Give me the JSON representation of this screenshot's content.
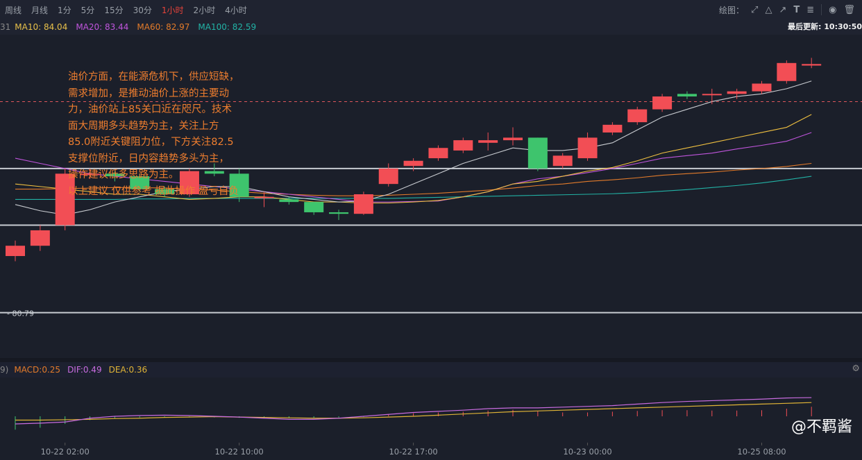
{
  "timeframes": [
    {
      "label": "周线",
      "active": false
    },
    {
      "label": "月线",
      "active": false
    },
    {
      "label": "1分",
      "active": false
    },
    {
      "label": "5分",
      "active": false
    },
    {
      "label": "15分",
      "active": false
    },
    {
      "label": "30分",
      "active": false
    },
    {
      "label": "1小时",
      "active": true
    },
    {
      "label": "2小时",
      "active": false
    },
    {
      "label": "4小时",
      "active": false
    }
  ],
  "drawing": {
    "label": "绘图："
  },
  "ma_bar": {
    "prefix": "31",
    "ma10": "MA10: 84.04",
    "ma20": "MA20: 83.44",
    "ma60": "MA60: 82.97",
    "ma100": "MA100: 82.59",
    "last_update": "最后更新: 10:30:50"
  },
  "macd_bar": {
    "prefix": "9)",
    "macd": "MACD:0.25",
    "dif": "DIF:0.49",
    "dea": "DEA:0.36"
  },
  "annotation": {
    "lines": [
      "油价方面，在能源危机下，供应短缺，",
      "需求增加，是推动油价上涨的主要动",
      "力，油价站上85关口近在咫尺。技术",
      "面大周期多头趋势为主，关注上方",
      "85.0附近关键阻力位，下方关注82.5",
      "支撑位附近，日内容趋势多头为主，",
      "操作建议低多思路为主。",
      "以上建议 仅供参考 据此操作 盈亏自负"
    ]
  },
  "watermark": {
    "text": "@不羁酱"
  },
  "colors": {
    "up": "#f24e55",
    "down": "#3ec46d",
    "ma10": "#c9ccd1",
    "ma20": "#f0c040",
    "ma60": "#c055dd",
    "ma100": "#e37b2a",
    "ma_extra": "#22b3a6",
    "dif": "#c96ce0",
    "dea": "#e0b436",
    "background": "#1b1f2a"
  },
  "chart_data": {
    "type": "candlestick",
    "price_label": "80.79",
    "current_price": 84.9,
    "x_tick_labels": [
      "10-22 02:00",
      "10-22 10:00",
      "10-22 17:00",
      "10-23 00:00",
      "10-25 08:00"
    ],
    "horizontal_levels": [
      83.6,
      82.5,
      80.8
    ],
    "candles": [
      {
        "o": 81.9,
        "c": 82.1,
        "h": 82.2,
        "l": 81.8
      },
      {
        "o": 82.1,
        "c": 82.4,
        "h": 82.5,
        "l": 82.0
      },
      {
        "o": 82.5,
        "c": 83.5,
        "h": 83.6,
        "l": 82.4
      },
      {
        "o": 83.5,
        "c": 83.5,
        "h": 83.6,
        "l": 83.4
      },
      {
        "o": 83.5,
        "c": 83.45,
        "h": 83.55,
        "l": 83.35
      },
      {
        "o": 83.45,
        "c": 83.2,
        "h": 83.5,
        "l": 83.15
      },
      {
        "o": 83.2,
        "c": 83.1,
        "h": 83.25,
        "l": 83.05
      },
      {
        "o": 83.1,
        "c": 83.55,
        "h": 83.6,
        "l": 83.05
      },
      {
        "o": 83.55,
        "c": 83.5,
        "h": 83.7,
        "l": 83.45
      },
      {
        "o": 83.5,
        "c": 83.05,
        "h": 83.6,
        "l": 82.95
      },
      {
        "o": 83.05,
        "c": 83.05,
        "h": 83.15,
        "l": 82.85
      },
      {
        "o": 83.0,
        "c": 82.95,
        "h": 83.05,
        "l": 82.9
      },
      {
        "o": 82.95,
        "c": 82.75,
        "h": 82.95,
        "l": 82.7
      },
      {
        "o": 82.75,
        "c": 82.72,
        "h": 82.8,
        "l": 82.6
      },
      {
        "o": 82.72,
        "c": 83.1,
        "h": 83.15,
        "l": 82.7
      },
      {
        "o": 83.3,
        "c": 83.6,
        "h": 83.7,
        "l": 83.25
      },
      {
        "o": 83.65,
        "c": 83.75,
        "h": 83.8,
        "l": 83.55
      },
      {
        "o": 83.8,
        "c": 84.0,
        "h": 84.05,
        "l": 83.75
      },
      {
        "o": 83.95,
        "c": 84.15,
        "h": 84.2,
        "l": 83.9
      },
      {
        "o": 84.1,
        "c": 84.15,
        "h": 84.3,
        "l": 83.95
      },
      {
        "o": 84.15,
        "c": 84.2,
        "h": 84.4,
        "l": 84.05
      },
      {
        "o": 84.2,
        "c": 83.6,
        "h": 84.2,
        "l": 83.55
      },
      {
        "o": 83.65,
        "c": 83.85,
        "h": 83.9,
        "l": 83.6
      },
      {
        "o": 83.8,
        "c": 84.2,
        "h": 84.3,
        "l": 83.75
      },
      {
        "o": 84.3,
        "c": 84.45,
        "h": 84.5,
        "l": 84.25
      },
      {
        "o": 84.5,
        "c": 84.75,
        "h": 84.8,
        "l": 84.45
      },
      {
        "o": 84.75,
        "c": 85.0,
        "h": 85.05,
        "l": 84.7
      },
      {
        "o": 85.05,
        "c": 85.0,
        "h": 85.1,
        "l": 84.95
      },
      {
        "o": 85.05,
        "c": 85.05,
        "h": 85.15,
        "l": 84.85
      },
      {
        "o": 85.05,
        "c": 85.1,
        "h": 85.15,
        "l": 84.95
      },
      {
        "o": 85.1,
        "c": 85.25,
        "h": 85.3,
        "l": 85.05
      },
      {
        "o": 85.3,
        "c": 85.65,
        "h": 85.7,
        "l": 85.25
      },
      {
        "o": 85.6,
        "c": 85.63,
        "h": 85.75,
        "l": 85.55
      }
    ],
    "ma10": [
      82.9,
      82.78,
      82.7,
      82.8,
      82.95,
      83.05,
      83.15,
      83.2,
      83.25,
      83.25,
      83.15,
      83.05,
      83.0,
      82.95,
      82.97,
      83.1,
      83.3,
      83.5,
      83.7,
      83.85,
      84.0,
      83.95,
      83.95,
      84.0,
      84.1,
      84.35,
      84.6,
      84.75,
      84.9,
      85.0,
      85.05,
      85.15,
      85.3
    ],
    "ma20": [
      83.3,
      83.25,
      83.2,
      83.15,
      83.1,
      83.1,
      83.05,
      83.0,
      83.02,
      83.05,
      83.05,
      83.0,
      82.95,
      82.95,
      82.93,
      82.93,
      82.95,
      82.98,
      83.05,
      83.15,
      83.3,
      83.35,
      83.45,
      83.55,
      83.62,
      83.75,
      83.9,
      84.0,
      84.1,
      84.2,
      84.3,
      84.4,
      84.65
    ],
    "ma60": [
      83.8,
      83.7,
      83.6,
      83.5,
      83.45,
      83.4,
      83.35,
      83.3,
      83.25,
      83.2,
      83.15,
      83.1,
      83.05,
      83.0,
      82.95,
      82.95,
      82.96,
      82.97,
      83.05,
      83.15,
      83.3,
      83.4,
      83.45,
      83.52,
      83.6,
      83.7,
      83.8,
      83.85,
      83.9,
      83.98,
      84.05,
      84.13,
      84.3
    ],
    "ma100": [
      83.2,
      83.2,
      83.21,
      83.22,
      83.23,
      83.23,
      83.22,
      83.2,
      83.18,
      83.15,
      83.12,
      83.1,
      83.08,
      83.07,
      83.07,
      83.08,
      83.1,
      83.12,
      83.15,
      83.18,
      83.22,
      83.27,
      83.3,
      83.35,
      83.38,
      83.42,
      83.47,
      83.5,
      83.53,
      83.57,
      83.6,
      83.64,
      83.7
    ],
    "ma_extra": [
      83.0,
      83.0,
      83.0,
      83.0,
      83.0,
      83.01,
      83.01,
      83.02,
      83.02,
      83.02,
      83.02,
      83.02,
      83.02,
      83.02,
      83.02,
      83.02,
      83.03,
      83.04,
      83.05,
      83.06,
      83.07,
      83.08,
      83.09,
      83.1,
      83.11,
      83.13,
      83.16,
      83.19,
      83.23,
      83.27,
      83.32,
      83.38,
      83.45
    ],
    "macd_hist": [
      -0.35,
      -0.3,
      -0.2,
      -0.1,
      -0.05,
      -0.03,
      -0.02,
      -0.02,
      -0.03,
      -0.04,
      -0.05,
      -0.05,
      -0.04,
      -0.03,
      -0.02,
      0.05,
      0.08,
      0.1,
      0.12,
      0.15,
      0.17,
      0.13,
      0.1,
      0.1,
      0.12,
      0.14,
      0.16,
      0.16,
      0.15,
      0.15,
      0.16,
      0.2,
      0.25
    ],
    "dif": [
      -0.2,
      -0.18,
      -0.15,
      -0.05,
      0.0,
      0.02,
      0.03,
      0.02,
      0.0,
      -0.02,
      -0.05,
      -0.08,
      -0.08,
      -0.05,
      0.0,
      0.05,
      0.1,
      0.13,
      0.16,
      0.2,
      0.22,
      0.22,
      0.24,
      0.26,
      0.28,
      0.32,
      0.36,
      0.39,
      0.41,
      0.43,
      0.45,
      0.48,
      0.49
    ],
    "dea": [
      -0.1,
      -0.1,
      -0.09,
      -0.08,
      -0.06,
      -0.05,
      -0.03,
      -0.02,
      -0.01,
      -0.02,
      -0.03,
      -0.04,
      -0.05,
      -0.05,
      -0.04,
      -0.02,
      0.0,
      0.03,
      0.06,
      0.09,
      0.12,
      0.14,
      0.16,
      0.18,
      0.2,
      0.22,
      0.24,
      0.26,
      0.28,
      0.3,
      0.32,
      0.34,
      0.36
    ]
  }
}
